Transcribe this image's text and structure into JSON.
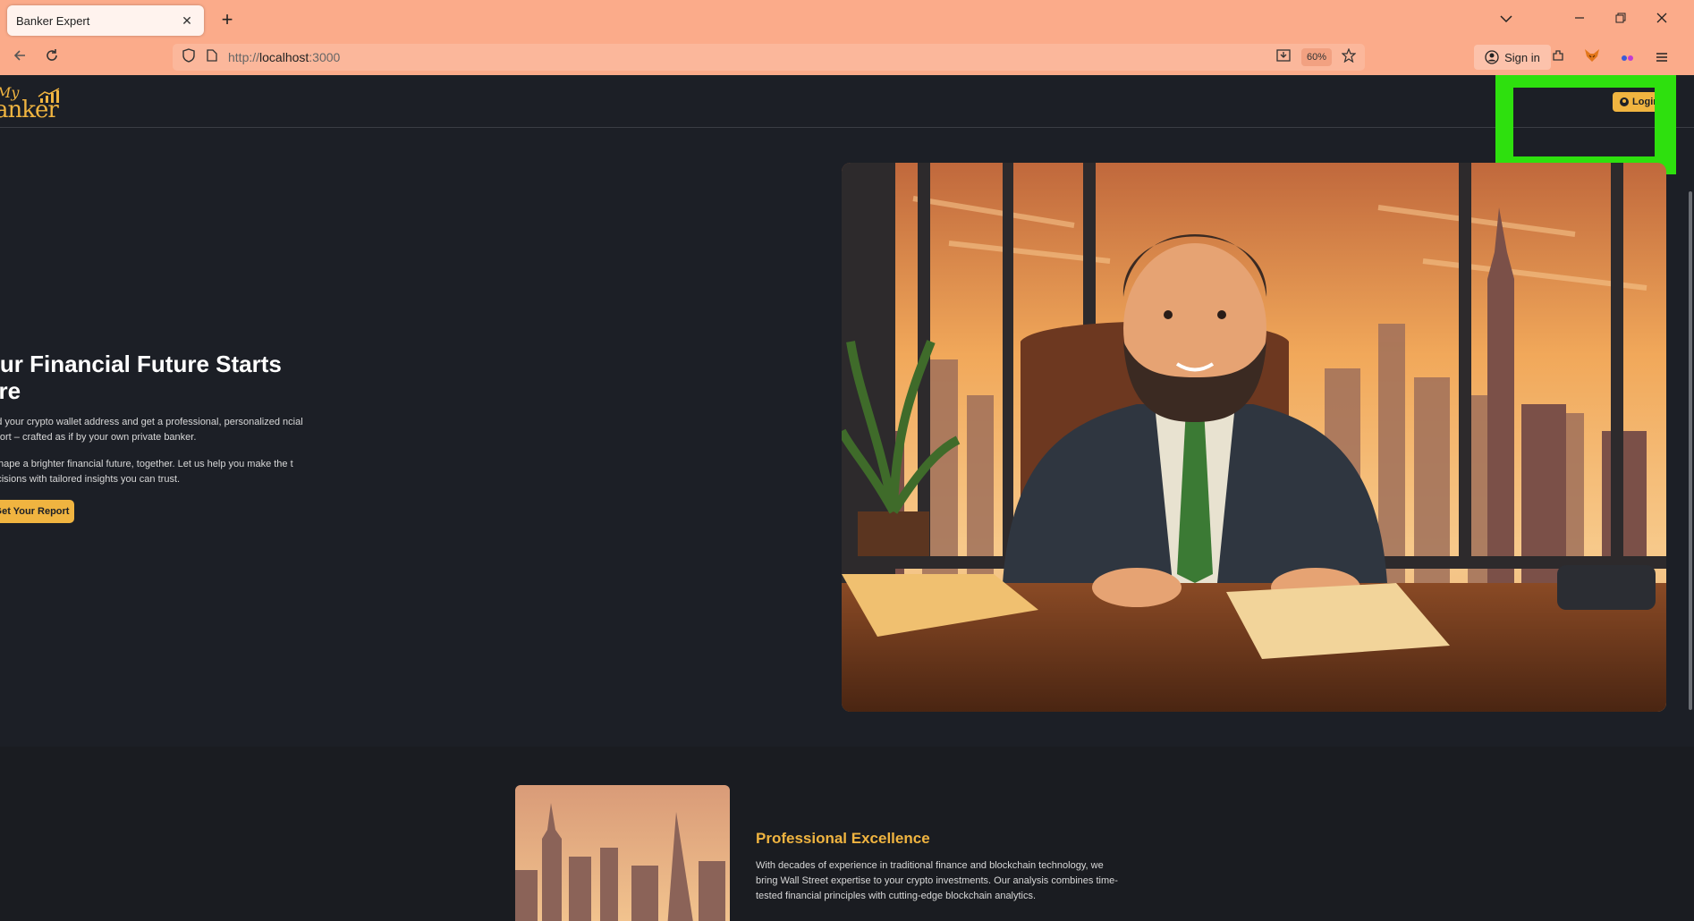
{
  "browser": {
    "tab_title": "Banker Expert",
    "tab_close": "✕",
    "new_tab": "+",
    "url_scheme": "http://",
    "url_host": "localhost",
    "url_port": ":3000",
    "zoom": "60%",
    "sign_in": "Sign in"
  },
  "site": {
    "logo_my": "My",
    "logo_banker": "anker",
    "login_label": "Login"
  },
  "hero": {
    "title": "our Financial Future Starts ere",
    "paragraph1": "oad your crypto wallet address and get a professional, personalized ncial report – crafted as if by your own private banker.",
    "paragraph2": "s shape a brighter financial future, together. Let us help you make the t decisions with tailored insights you can trust.",
    "cta_label": "Get Your Report"
  },
  "feature": {
    "title": "Professional Excellence",
    "text": "With decades of experience in traditional finance and blockchain technology, we bring Wall Street expertise to your crypto investments. Our analysis combines time-tested financial principles with cutting-edge blockchain analytics."
  },
  "colors": {
    "accent": "#f0b440",
    "chrome": "#fbab8a",
    "page_bg": "#1c1f26",
    "highlight": "#2ee00e"
  },
  "icons": {
    "tab_list": "chevron-down-icon",
    "back": "arrow-left-icon",
    "reload": "reload-icon",
    "shield": "shield-icon",
    "page": "page-icon",
    "download": "download-icon",
    "star": "star-icon",
    "account": "account-icon",
    "extensions": "extensions-icon",
    "fox": "fox-extension-icon",
    "menu": "hamburger-menu-icon"
  }
}
